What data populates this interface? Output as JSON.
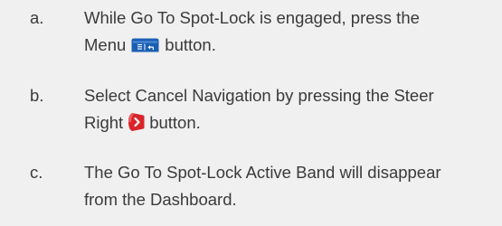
{
  "steps": [
    {
      "letter": "a.",
      "line1": "While Go To Spot-Lock is engaged, press the",
      "line2_before": "Menu",
      "icon": "menu-button-icon",
      "line2_after": "button."
    },
    {
      "letter": "b.",
      "line1": "Select Cancel Navigation by pressing the Steer",
      "line2_before": "Right",
      "icon": "steer-right-icon",
      "line2_after": "button."
    },
    {
      "letter": "c.",
      "line1": "The Go To Spot-Lock Active Band will disappear",
      "line2": "from the Dashboard."
    }
  ],
  "colors": {
    "background": "#f0f0f0",
    "text": "#3a3a3a",
    "menu_icon": "#1b5fb4",
    "steer_icon": "#d9252a"
  }
}
